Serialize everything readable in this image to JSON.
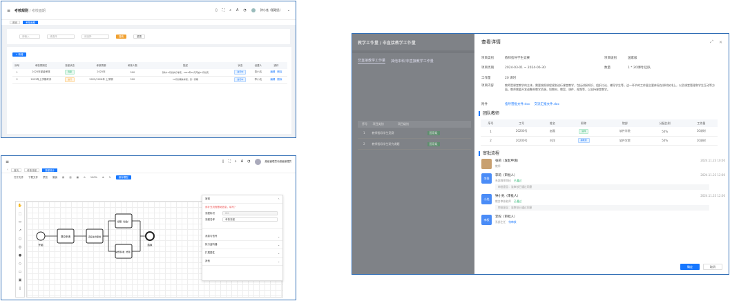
{
  "win1": {
    "breadcrumb_root": "考核规则",
    "breadcrumb_sep": "/",
    "breadcrumb_current": "考核面期",
    "user": "钟小兆（管理员）",
    "tabs": [
      "首页",
      "考核面期"
    ],
    "filters": {
      "f1": "请输入",
      "f2": "请选择",
      "f3": "请选择",
      "search": "搜索",
      "reset": "重置"
    },
    "add_label": "+ 新增",
    "columns": [
      "序号",
      "考核周期名",
      "流程状态",
      "考核周期",
      "考核人数",
      "描述",
      "状态",
      "创建人",
      "操作"
    ],
    "rows": [
      {
        "no": "1",
        "name": "2025年部级审核",
        "state": "待审",
        "period": "2025年",
        "count": "500",
        "desc": "暂时12月份执行考核，2025年10月开始11月份完",
        "status": "进行中",
        "creator": "张小兆",
        "op1": "编辑",
        "op2": "删除"
      },
      {
        "no": "2",
        "name": "2025年上学期考评",
        "state": "进行",
        "period": "2025/2026年 上学期",
        "count": "500",
        "desc": "12月份期末考核，另一周期",
        "status": "进行中",
        "creator": "李小兆",
        "op1": "编辑",
        "op2": "删除"
      }
    ]
  },
  "win2": {
    "user": "超级管理员@超级管理员",
    "tabs": [
      "首页",
      "考核流程",
      "流程设计"
    ],
    "tools": [
      "打开文件",
      "下载文件",
      "预览",
      "撤销",
      "100%",
      "保存模型"
    ],
    "nodes": {
      "start": "开始",
      "t1": "提交申请",
      "t2": "直接主管审批",
      "t3": "经理（总监）",
      "t4": "总经理审批（经理）",
      "end": "结束"
    },
    "panel": {
      "title": "常规",
      "warn": "请补充流程基础信息，填写？",
      "id_label": "流程标识",
      "id_value": "ID1",
      "name_label": "流程名称",
      "name_value": "考核流程",
      "s2": "消息与信号",
      "s3": "执行监听器",
      "s4": "扩展属性",
      "s5": "其他"
    }
  },
  "win3": {
    "bg_title": "教学工作量 / 非直接教学工作量",
    "bg_tab1": "非直接教学工作量",
    "bg_tab2": "其他本科/非直接教学工作量",
    "bg_rows": [
      {
        "no": "1",
        "name": "教师指导学生竞赛",
        "tag": "国家级"
      },
      {
        "no": "2",
        "name": "教师指导学生研究课题",
        "tag": "国家级"
      }
    ],
    "title": "查看详情",
    "fields": {
      "category_label": "项目类别",
      "category": "教师指导学生竞赛",
      "level_label": "项目级别",
      "level": "国家级",
      "period_label": "项目周期",
      "period": "2024-03-01 ~ 2024-06-30",
      "qty_label": "数量",
      "qty": "1 * 20课时/团队",
      "workload_label": "工作量",
      "workload": "20 课时",
      "content_label": "项目内容",
      "content": "教师是课堂教学的主体，需要按照课程规划进行课堂教学，包括讲授知识、组织讨论、辅导学生等。这一环节的工作量主要体现在课时安排上，以及课堂管理和学生互动等方面。教师需要开发或整合教学资源，如教材、教案、课件、视频等，以支持课堂教学。",
      "attach_label": "附件",
      "attach1": "指导营批文件.doc",
      "attach2": "交流汇报文件.doc"
    },
    "team_title": "团队教师",
    "team_cols": [
      "序号",
      "工号",
      "姓名",
      "职称",
      "院部",
      "分配比例",
      "工作量"
    ],
    "team": [
      {
        "no": "1",
        "id": "20200号",
        "name": "赵磊",
        "title": "讲师",
        "dept": "软件学院",
        "ratio": "50%",
        "load": "10课时"
      },
      {
        "no": "2",
        "id": "20200号",
        "name": "刘洋",
        "title": "副教授",
        "dept": "软件学院",
        "ratio": "50%",
        "load": "10课时"
      }
    ],
    "flow_title": "审批流程",
    "flow": [
      {
        "av": "",
        "name": "张莉（发起申请）",
        "sub": "教师",
        "status": "",
        "time": "2024.11.23 10:00",
        "note": ""
      },
      {
        "av": "李莉",
        "name": "李莉（审批人）",
        "sub": "系部教师审核",
        "status": "已通过",
        "time": "2024.11.23 12:00",
        "note": "审批意见：该审核已通过同意"
      },
      {
        "av": "小兆",
        "name": "钟小兆（审批人）",
        "sub": "教务审核老师",
        "status": "已通过",
        "time": "2024.11.23 12:00",
        "note": "审批意见：该审核已通过同意"
      },
      {
        "av": "李权",
        "name": "李权（审批人）",
        "sub": "系部主任",
        "status": "待审核",
        "time": "",
        "note": ""
      }
    ],
    "confirm": "确定",
    "cancel": "取消"
  }
}
